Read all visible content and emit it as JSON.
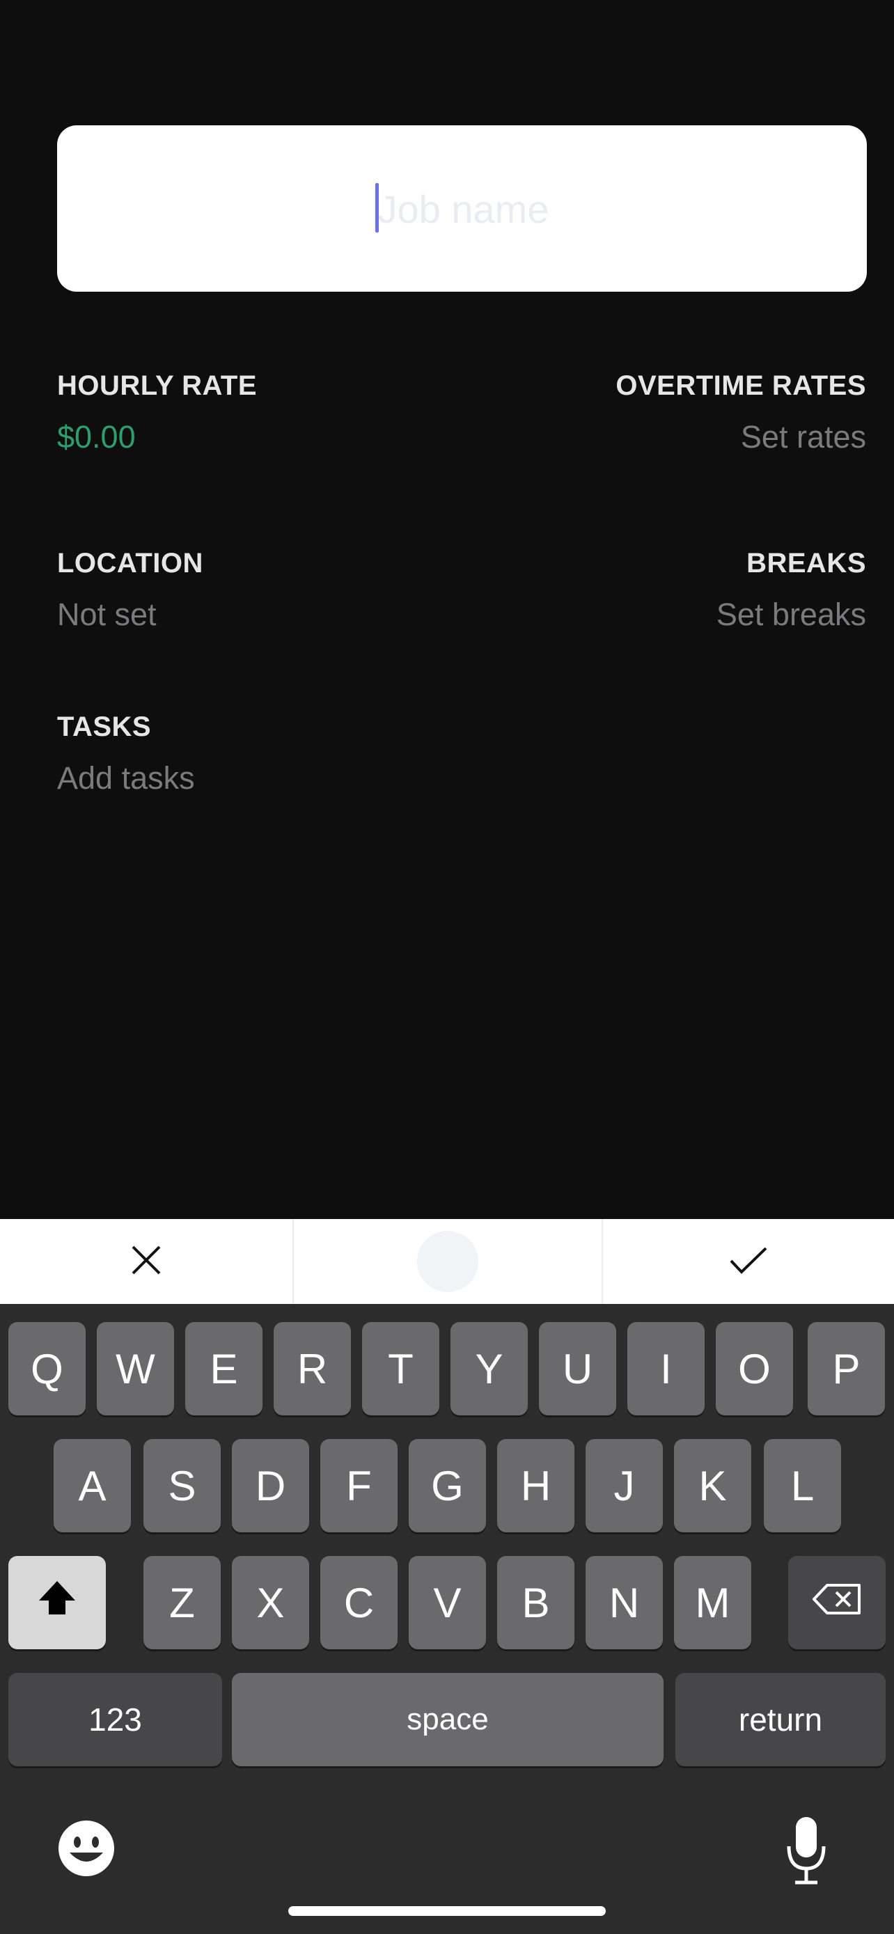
{
  "job_name": {
    "placeholder": "Job name",
    "value": ""
  },
  "fields": {
    "hourly_rate": {
      "label": "HOURLY RATE",
      "value": "$0.00"
    },
    "overtime_rates": {
      "label": "OVERTIME RATES",
      "value": "Set rates"
    },
    "location": {
      "label": "LOCATION",
      "value": "Not set"
    },
    "breaks": {
      "label": "BREAKS",
      "value": "Set breaks"
    },
    "tasks": {
      "label": "TASKS",
      "value": "Add tasks"
    }
  },
  "accessory_bar": {
    "cancel_icon": "close-icon",
    "middle_icon": "circle",
    "confirm_icon": "checkmark-icon"
  },
  "keyboard": {
    "row1": [
      "Q",
      "W",
      "E",
      "R",
      "T",
      "Y",
      "U",
      "I",
      "O",
      "P"
    ],
    "row2": [
      "A",
      "S",
      "D",
      "F",
      "G",
      "H",
      "J",
      "K",
      "L"
    ],
    "row3": [
      "Z",
      "X",
      "C",
      "V",
      "B",
      "N",
      "M"
    ],
    "numbers_label": "123",
    "space_label": "space",
    "return_label": "return"
  },
  "colors": {
    "background": "#0e0e0f",
    "rate_value": "#2e9e6d",
    "caret": "#6a72e8"
  }
}
